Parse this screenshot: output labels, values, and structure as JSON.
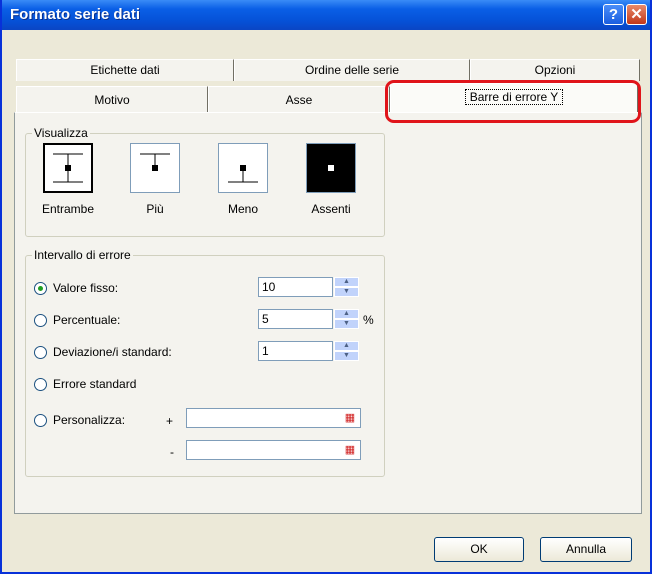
{
  "window": {
    "title": "Formato serie dati",
    "help_glyph": "?",
    "close_glyph": "✕"
  },
  "tabs": {
    "row_back": [
      "Etichette dati",
      "Ordine delle serie",
      "Opzioni"
    ],
    "row_front": [
      "Motivo",
      "Asse",
      "Barre di errore Y"
    ],
    "active": "Barre di errore Y"
  },
  "visualizza": {
    "title": "Visualizza",
    "options": [
      {
        "label": "Entrambe",
        "icon": "error-bar-both-icon",
        "selected": true
      },
      {
        "label": "Più",
        "icon": "error-bar-plus-icon",
        "selected": false
      },
      {
        "label": "Meno",
        "icon": "error-bar-minus-icon",
        "selected": false
      },
      {
        "label": "Assenti",
        "icon": "error-bar-none-icon",
        "selected": false
      }
    ]
  },
  "intervallo": {
    "title": "Intervallo di errore",
    "valore_fisso": {
      "label": "Valore fisso:",
      "value": "10",
      "selected": true
    },
    "percentuale": {
      "label": "Percentuale:",
      "value": "5",
      "unit": "%"
    },
    "deviazione": {
      "label": "Deviazione/i standard:",
      "value": "1"
    },
    "errore_standard": {
      "label": "Errore standard"
    },
    "personalizza": {
      "label": "Personalizza:",
      "plus_sign": "+",
      "minus_sign": "-",
      "plus_value": "",
      "minus_value": ""
    }
  },
  "buttons": {
    "ok": "OK",
    "cancel": "Annulla"
  },
  "colors": {
    "title_bar": "#0a5fe6",
    "dialog_bg": "#ece9d8",
    "highlight": "#e0141a",
    "radio_dot": "#1f9e22"
  }
}
